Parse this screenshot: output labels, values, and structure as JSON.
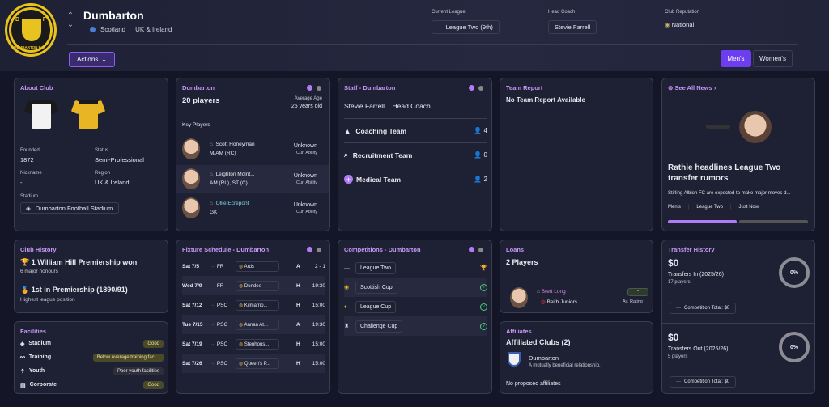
{
  "header": {
    "club_name": "Dumbarton",
    "country": "Scotland",
    "region": "UK & Ireland",
    "current_league_label": "Current League",
    "current_league": "League Two (9th)",
    "head_coach_label": "Head Coach",
    "head_coach": "Stevie Farrell",
    "reputation_label": "Club Reputation",
    "reputation": "National",
    "actions_label": "Actions",
    "men_label": "Men's",
    "women_label": "Women's",
    "crest_text": "DUMBARTON F.C."
  },
  "about": {
    "title": "About Club",
    "founded_label": "Founded",
    "founded": "1872",
    "status_label": "Status",
    "status": "Semi-Professional",
    "nickname_label": "Nickname",
    "nickname": "-",
    "region_label": "Region",
    "region": "UK & Ireland",
    "stadium_label": "Stadium",
    "stadium": "Dumbarton Football Stadium",
    "colors": {
      "home_primary": "#f2f2f2",
      "home_secondary": "#1a1a1a",
      "away_primary": "#e8b524",
      "away_secondary": "#1a1a1a"
    }
  },
  "squad": {
    "title": "Dumbarton",
    "count": "20 players",
    "avg_age_label": "Average Age",
    "avg_age": "25 years old",
    "key_players_label": "Key Players",
    "players": [
      {
        "name": "Scott Honeyman",
        "pos": "M/AM (RC)",
        "ability": "Unknown",
        "ability_label": "Cur. Ability"
      },
      {
        "name": "Leighton McInt...",
        "pos": "AM (RL), ST (C)",
        "ability": "Unknown",
        "ability_label": "Cur. Ability"
      },
      {
        "name": "Ollie Ecrepont",
        "pos": "GK",
        "ability": "Unknown",
        "ability_label": "Cur. Ability"
      }
    ]
  },
  "staff": {
    "title": "Staff - Dumbarton",
    "head_coach": "Stevie Farrell",
    "head_coach_role": "Head Coach",
    "rows": [
      {
        "label": "Coaching Team",
        "count": "4"
      },
      {
        "label": "Recruitment Team",
        "count": "0"
      },
      {
        "label": "Medical Team",
        "count": "2"
      }
    ]
  },
  "team_report": {
    "title": "Team Report",
    "text": "No Team Report Available"
  },
  "news": {
    "see_all": "See All News",
    "headline": "Rathie headlines League Two transfer rumors",
    "snippet": "Stirling Albion FC are expected to make major moves d...",
    "tags": [
      "Men's",
      "League Two",
      "Just Now"
    ]
  },
  "history": {
    "title": "Club History",
    "honour": "1 William Hill Premiership won",
    "honour_sub": "6 major honours",
    "league": "1st in Premiership (1890/91)",
    "league_sub": "Highest league position"
  },
  "fixtures": {
    "title": "Fixture Schedule - Dumbarton",
    "rows": [
      {
        "date": "Sat 7/5",
        "comp": "FR",
        "team": "Ards",
        "venue": "A",
        "result": "2 - 1"
      },
      {
        "date": "Wed 7/9",
        "comp": "FR",
        "team": "Dundee",
        "venue": "H",
        "result": "19:30"
      },
      {
        "date": "Sat 7/12",
        "comp": "PSC",
        "team": "Kilmarno...",
        "venue": "H",
        "result": "15:00"
      },
      {
        "date": "Tue 7/15",
        "comp": "PSC",
        "team": "Annan At...",
        "venue": "A",
        "result": "19:30"
      },
      {
        "date": "Sat 7/19",
        "comp": "PSC",
        "team": "Stenhous...",
        "venue": "H",
        "result": "15:00"
      },
      {
        "date": "Sat 7/26",
        "comp": "PSC",
        "team": "Queen's P...",
        "venue": "H",
        "result": "15:00"
      }
    ]
  },
  "competitions": {
    "title": "Competitions - Dumbarton",
    "rows": [
      "League Two",
      "Scottish Cup",
      "League Cup",
      "Challenge Cup"
    ]
  },
  "loans": {
    "title": "Loans",
    "count": "2 Players",
    "player": "Brett Long",
    "club": "Beith Juniors",
    "rating": "-",
    "rating_label": "Av. Rating"
  },
  "affiliates": {
    "title": "Affiliates",
    "heading": "Affiliated Clubs (2)",
    "club": "Dumbarton",
    "desc": "A mutually beneficial relationship.",
    "none": "No proposed affiliates"
  },
  "transfers": {
    "title": "Transfer History",
    "in": {
      "amount": "$0",
      "label": "Transfers In (2025/26)",
      "players": "17 players",
      "pct": "0%",
      "total": "Competition Total: $0"
    },
    "out": {
      "amount": "$0",
      "label": "Transfers Out (2025/26)",
      "players": "5 players",
      "pct": "0%",
      "total": "Competition Total: $0"
    }
  },
  "facilities": {
    "title": "Facilities",
    "rows": [
      {
        "label": "Stadium",
        "value": "Good"
      },
      {
        "label": "Training",
        "value": "Below Average training faci..."
      },
      {
        "label": "Youth",
        "value": "Poor youth facilities"
      },
      {
        "label": "Corporate",
        "value": "Good"
      }
    ]
  }
}
